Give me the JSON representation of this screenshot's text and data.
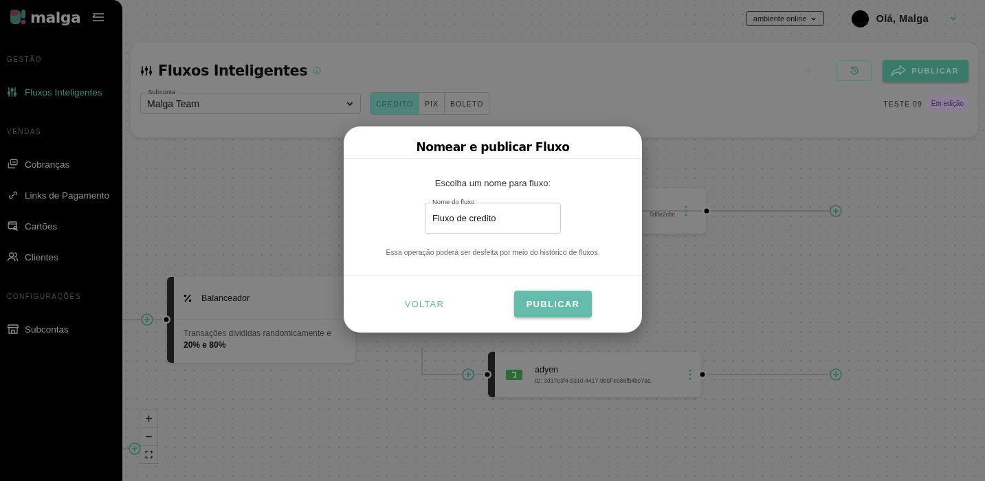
{
  "sidebar": {
    "logo": "malga",
    "sections": [
      {
        "title": "GESTÃO",
        "items": [
          {
            "label": "Fluxos Inteligentes",
            "selected": true
          }
        ]
      },
      {
        "title": "VENDAS",
        "items": [
          {
            "label": "Cobranças",
            "selected": false
          },
          {
            "label": "Links de Pagamento",
            "selected": false
          },
          {
            "label": "Cartões",
            "selected": false
          },
          {
            "label": "Clientes",
            "selected": false
          }
        ]
      },
      {
        "title": "CONFIGURAÇÕES",
        "items": [
          {
            "label": "Subcontas",
            "selected": false
          }
        ]
      }
    ]
  },
  "header": {
    "environment": "ambiente online",
    "greeting": "Olá, Malga"
  },
  "toolbar": {
    "title": "Fluxos Inteligentes",
    "subaccount": {
      "label": "Subconta",
      "value": "Malga Team"
    },
    "methods": [
      {
        "label": "CRÉDITO",
        "selected": true
      },
      {
        "label": "PIX",
        "selected": false
      },
      {
        "label": "BOLETO",
        "selected": false
      }
    ],
    "publish": "PUBLICAR",
    "flow_name": "TESTE 09",
    "status": "Em edição"
  },
  "canvas": {
    "nodes": [
      {
        "kind": "provider-partial",
        "id": "0d8e2cbc"
      },
      {
        "kind": "balancer",
        "title": "Balanceador",
        "description": "Transações divididas randomicamente e",
        "detail": "20% e 80%"
      },
      {
        "kind": "provider",
        "title": "adyen",
        "id": "ID: 3d17e3f4-9310-4417-9b5f-e088fb4be7aa"
      }
    ]
  },
  "dialog": {
    "title": "Nomear e publicar Fluxo",
    "prompt": "Escolha um nome para fluxo:",
    "field": {
      "label": "Nome do fluxo",
      "value": "Fluxo de credito"
    },
    "note": "Essa operação poderá ser desfeita por meio do histórico de fluxos.",
    "buttons": [
      {
        "label": "VOLTAR",
        "kind": "text"
      },
      {
        "label": "PUBLICAR",
        "kind": "primary"
      }
    ]
  }
}
